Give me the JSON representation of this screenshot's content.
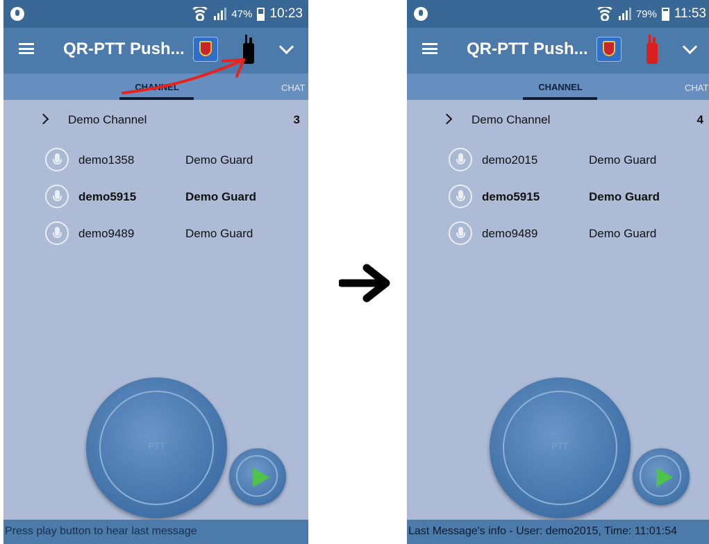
{
  "panels": [
    {
      "status_bar": {
        "battery_pct": "47%",
        "time": "10:23",
        "battery_level": 0.47
      },
      "toolbar": {
        "title": "QR-PTT Push...",
        "shield_icon": "qr-shield-icon",
        "radio_icon": "walkie-talkie-icon",
        "radio_color": "#000000"
      },
      "tabs": {
        "channel": "CHANNEL",
        "chat": "CHAT"
      },
      "channel": {
        "name": "Demo Channel",
        "count": "3"
      },
      "members": [
        {
          "name": "demo1358",
          "role": "Demo Guard"
        },
        {
          "name": "demo5915",
          "role": "Demo Guard"
        },
        {
          "name": "demo9489",
          "role": "Demo Guard"
        }
      ],
      "ptt_label": "PTT",
      "bottom_text": "Press play button to hear last message"
    },
    {
      "status_bar": {
        "battery_pct": "79%",
        "time": "11:53",
        "battery_level": 0.79
      },
      "toolbar": {
        "title": "QR-PTT Push...",
        "shield_icon": "qr-shield-icon",
        "radio_icon": "walkie-talkie-icon",
        "radio_color": "#d9201a"
      },
      "tabs": {
        "channel": "CHANNEL",
        "chat": "CHAT"
      },
      "channel": {
        "name": "Demo Channel",
        "count": "4"
      },
      "members": [
        {
          "name": "demo2015",
          "role": "Demo Guard"
        },
        {
          "name": "demo5915",
          "role": "Demo Guard"
        },
        {
          "name": "demo9489",
          "role": "Demo Guard"
        }
      ],
      "ptt_label": "PTT",
      "bottom_text": "Last Message's info - User: demo2015, Time: 11:01:54"
    }
  ],
  "colors": {
    "accent": "#4c7bab",
    "status_bar": "#3a6896",
    "background": "#aebbd6",
    "play_green": "#4fc24a",
    "annotation_red": "#e8231e"
  }
}
